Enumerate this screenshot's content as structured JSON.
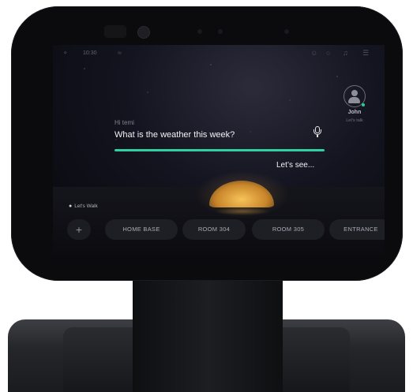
{
  "status": {
    "time": "10:30",
    "icons": [
      "mic-icon",
      "wifi-icon",
      "person-icon",
      "bell-icon",
      "music-icon",
      "menu-icon"
    ]
  },
  "user": {
    "name": "John",
    "subtitle": "Let's talk",
    "online_color": "#2ecc8f"
  },
  "assistant": {
    "greeting": "Hi temi",
    "query": "What is the weather this week?",
    "reply": "Let’s see...",
    "accent_color": "#2fd0a2"
  },
  "locations": {
    "label": "Let's Walk",
    "add_label": "+",
    "items": [
      "HOME BASE",
      "ROOM 304",
      "ROOM 305",
      "ENTRANCE"
    ]
  }
}
